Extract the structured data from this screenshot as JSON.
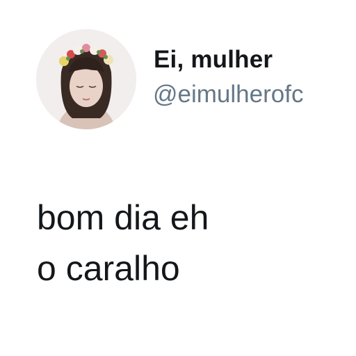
{
  "author": {
    "display_name": "Ei, mulher",
    "handle": "@eimulherofc",
    "avatar_icon": "profile-photo-flower-crown"
  },
  "tweet": {
    "lines": [
      "bom dia eh",
      "o caralho"
    ]
  },
  "colors": {
    "background": "#ffffff",
    "name_text": "#14171a",
    "handle_text": "#657786",
    "body_text": "#14171a"
  }
}
